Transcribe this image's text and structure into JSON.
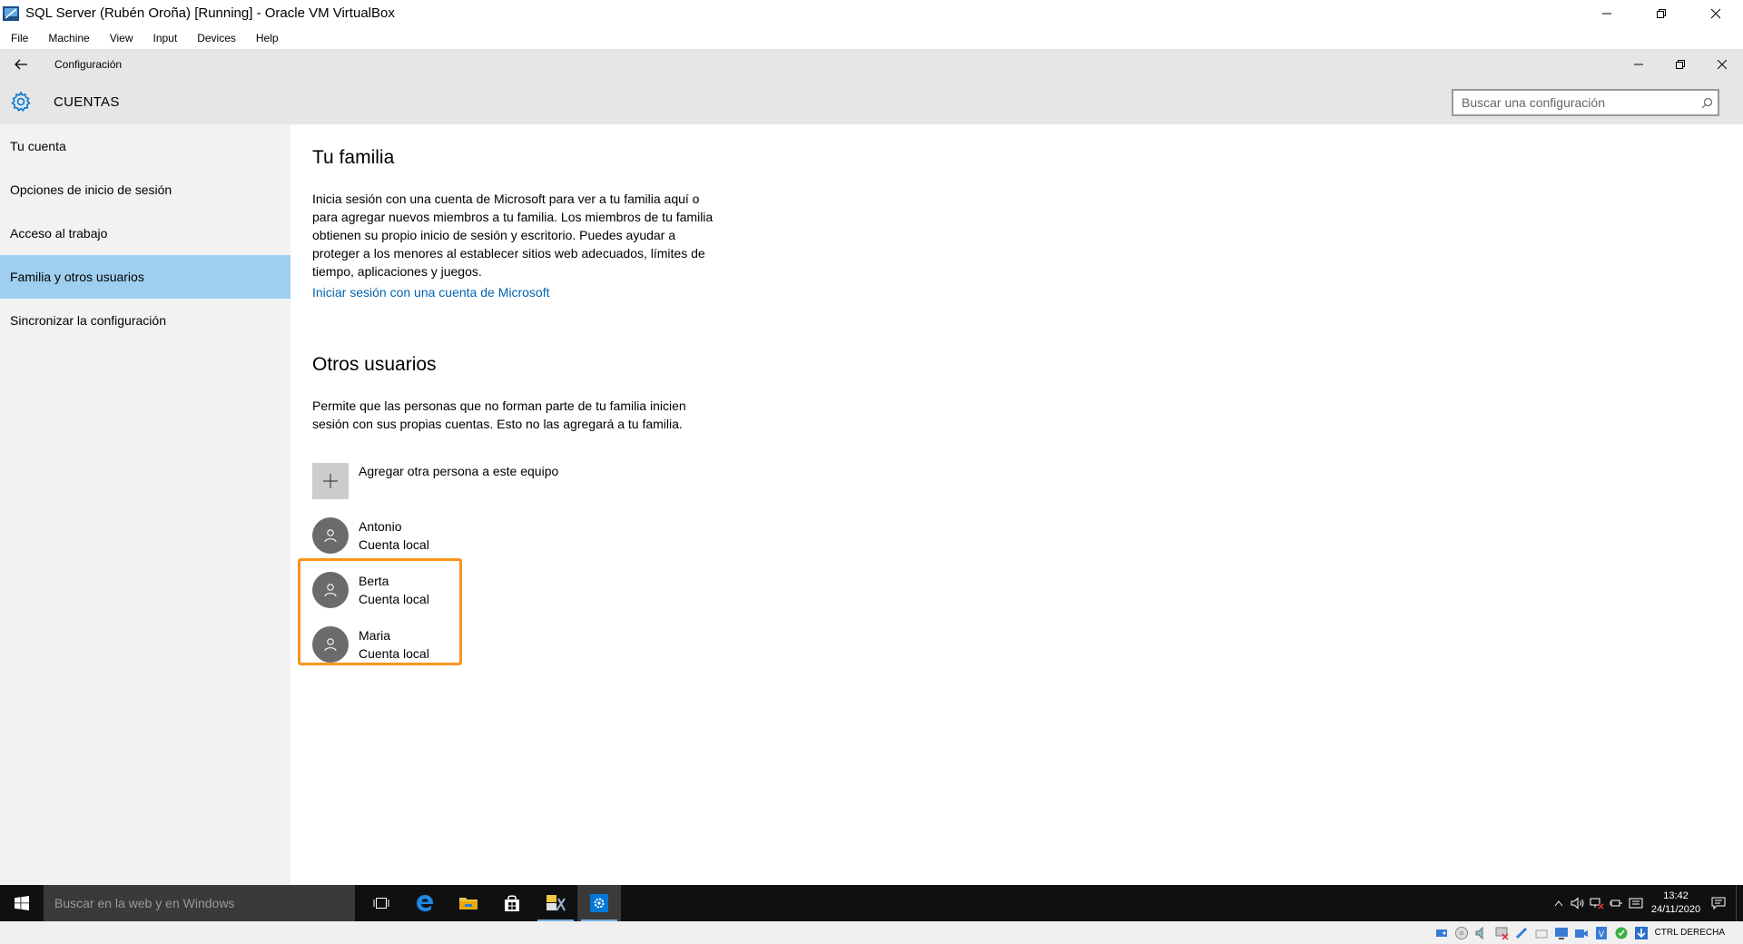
{
  "vbox": {
    "title": "SQL Server (Rubén Oroña) [Running] - Oracle VM VirtualBox",
    "menu": [
      "File",
      "Machine",
      "View",
      "Input",
      "Devices",
      "Help"
    ],
    "host_key": "CTRL DERECHA"
  },
  "settings": {
    "window_title": "Configuración",
    "header_title": "CUENTAS",
    "search_placeholder": "Buscar una configuración",
    "nav": [
      {
        "label": "Tu cuenta",
        "active": false
      },
      {
        "label": "Opciones de inicio de sesión",
        "active": false
      },
      {
        "label": "Acceso al trabajo",
        "active": false
      },
      {
        "label": "Familia y otros usuarios",
        "active": true
      },
      {
        "label": "Sincronizar la configuración",
        "active": false
      }
    ],
    "family": {
      "heading": "Tu familia",
      "description": "Inicia sesión con una cuenta de Microsoft para ver a tu familia aquí o para agregar nuevos miembros a tu familia. Los miembros de tu familia obtienen su propio inicio de sesión y escritorio. Puedes ayudar a proteger a los menores al establecer sitios web adecuados, límites de tiempo, aplicaciones y juegos.",
      "link": "Iniciar sesión con una cuenta de Microsoft"
    },
    "others": {
      "heading": "Otros usuarios",
      "description": "Permite que las personas que no forman parte de tu familia inicien sesión con sus propias cuentas. Esto no las agregará a tu familia.",
      "add_label": "Agregar otra persona a este equipo",
      "users": [
        {
          "name": "Antonio",
          "type": "Cuenta local"
        },
        {
          "name": "Berta",
          "type": "Cuenta local"
        },
        {
          "name": "Maria",
          "type": "Cuenta local"
        }
      ]
    }
  },
  "taskbar": {
    "search_placeholder": "Buscar en la web y en Windows",
    "time": "13:42",
    "date": "24/11/2020"
  },
  "colors": {
    "accent": "#0078d7",
    "nav_active": "#9fcff0",
    "link": "#0063b1",
    "highlight": "#f7941d"
  }
}
